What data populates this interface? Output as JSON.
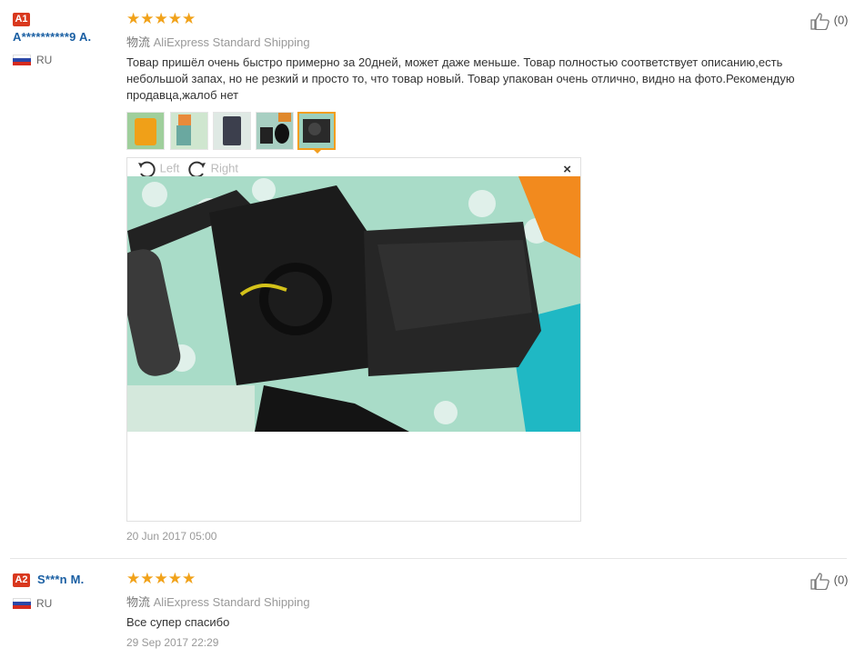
{
  "reviews": [
    {
      "badge": "A1",
      "user": "A**********9 A.",
      "country": "RU",
      "stars": "★★★★★",
      "logistics_cn": "物流",
      "shipping": "AliExpress Standard Shipping",
      "text": "Товар пришёл очень быстро примерно за 20дней, может даже меньше. Товар полностью соответствует описанию,есть небольшой запах, но не резкий и просто то, что товар новый. Товар упакован очень отлично, видно на фото.Рекомендую продавца,жалоб нет",
      "likes": "(0)",
      "date": "20 Jun 2017 05:00",
      "viewer": {
        "left": "Left",
        "right": "Right",
        "close": "×"
      }
    },
    {
      "badge": "A2",
      "user": "S***n M.",
      "country": "RU",
      "stars": "★★★★★",
      "logistics_cn": "物流",
      "shipping": "AliExpress Standard Shipping",
      "text": "Все супер спасибо",
      "likes": "(0)",
      "date": "29 Sep 2017 22:29"
    }
  ],
  "colors": {
    "accent": "#f29e1e",
    "username": "#1a5fa3",
    "badge": "#d9381e",
    "star": "#f1a21a"
  }
}
